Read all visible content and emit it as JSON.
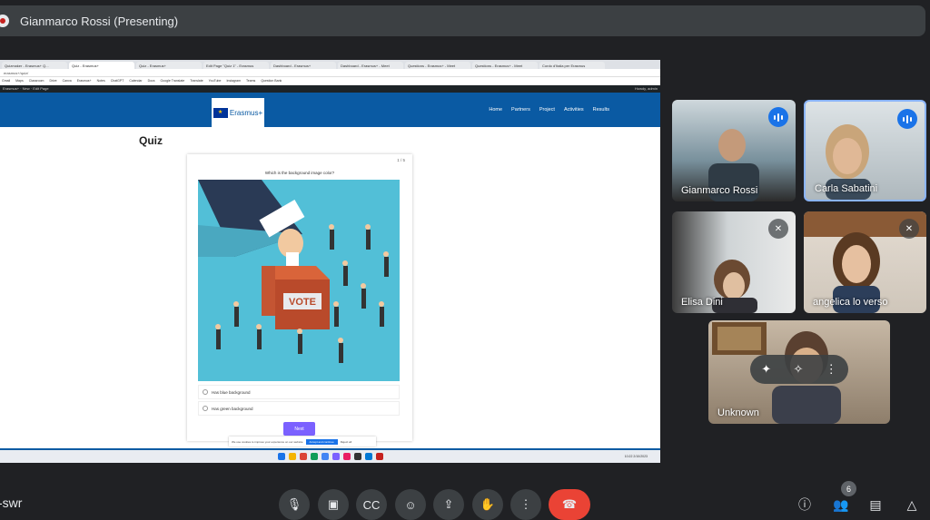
{
  "presenter_bar": {
    "title": "Gianmarco Rossi (Presenting)"
  },
  "browser": {
    "tabs": [
      "Quizmaker - Erasmus+ Q...",
      "Quiz - Erasmus+",
      "Quiz - Erasmus+",
      "Edit Page \"Quiz 1\" - Erasmus",
      "Dashboard - Erasmus+",
      "Dashboard - Erasmus+ - Meet",
      "Questions - Erasmus+ - Meet",
      "Questions - Erasmus+ - Meet",
      "Cordo d'Italia per Erasmus"
    ],
    "address": "erasmus+/quiz/",
    "bookmarks": [
      "Gmail",
      "Maps",
      "Classroom",
      "Drive",
      "Canva",
      "Erasmus+",
      "Notes",
      "ChatGPT",
      "Calendar",
      "Docs",
      "Google Translate",
      "Translate",
      "YouTube",
      "Instagram",
      "Teams",
      "Question Bank"
    ],
    "wp_bar": "Erasmus+  ·  New  ·  Edit Page",
    "wp_right": "Howdy, admin"
  },
  "site": {
    "logo": "Erasmus+",
    "nav": [
      "Home",
      "Partners",
      "Project",
      "Activities",
      "Results"
    ],
    "quiz_title": "Quiz"
  },
  "quiz": {
    "counter": "1 / 5",
    "question": "Which is the background image color?",
    "vote_label": "VOTE",
    "options": [
      "Has blue background",
      "Has green background"
    ],
    "next_label": "Next"
  },
  "cookie": {
    "text": "We use cookies to improve your experience on our website",
    "accept": "Accept and continue",
    "reject": "Reject all"
  },
  "taskbar_clock": "10:22  2/10/2023",
  "participants": [
    {
      "name": "Gianmarco Rossi",
      "status": "speaking"
    },
    {
      "name": "Carla Sabatini",
      "status": "speaking"
    },
    {
      "name": "Elisa Dini",
      "status": "muted"
    },
    {
      "name": "angelica lo verso",
      "status": "muted"
    },
    {
      "name": "Unknown",
      "status": "hover"
    }
  ],
  "meeting_code": "-swr",
  "controls": {
    "icons": [
      "mic-icon",
      "camera-icon",
      "captions-icon",
      "emoji-icon",
      "present-icon",
      "hand-icon",
      "more-icon",
      "end-call-icon"
    ],
    "participant_count": "6"
  },
  "colors": {
    "bg": "#202124",
    "accent": "#1a73e8",
    "end_call": "#ea4335",
    "site_blue": "#0a5aa3",
    "quiz_bg": "#52bfd7",
    "next_btn": "#7b61ff"
  }
}
